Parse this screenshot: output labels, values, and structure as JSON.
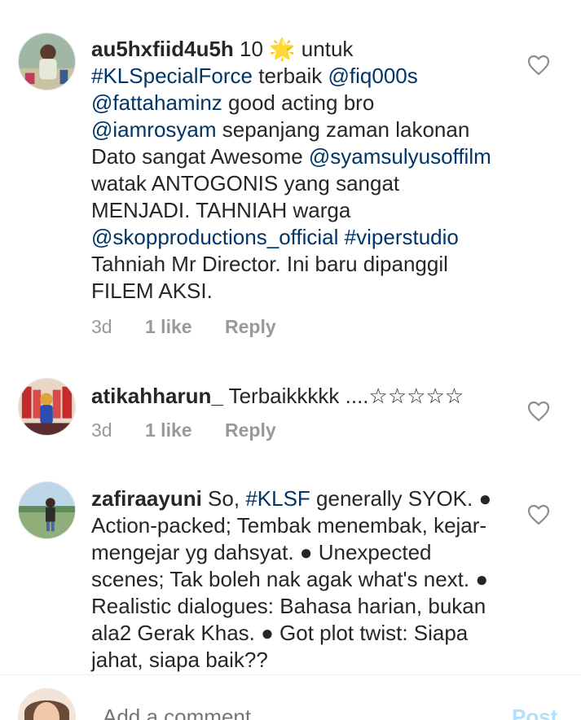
{
  "comments": [
    {
      "username": "au5hxfiid4u5h",
      "segments": [
        {
          "t": " 10 ",
          "link": false
        },
        {
          "t": "🌟",
          "link": false
        },
        {
          "t": " untuk ",
          "link": false
        },
        {
          "t": "#KLSpecialForce",
          "link": true
        },
        {
          "t": " terbaik ",
          "link": false
        },
        {
          "t": "@fiq000s",
          "link": true
        },
        {
          "t": " ",
          "link": false
        },
        {
          "t": "@fattahaminz",
          "link": true
        },
        {
          "t": " good acting bro ",
          "link": false
        },
        {
          "t": "@iamrosyam",
          "link": true
        },
        {
          "t": " sepanjang zaman lakonan Dato sangat Awesome ",
          "link": false
        },
        {
          "t": "@syamsulyusoffilm",
          "link": true
        },
        {
          "t": " watak ANTOGONIS yang sangat MENJADI. TAHNIAH warga ",
          "link": false
        },
        {
          "t": "@skopproductions_official",
          "link": true
        },
        {
          "t": " ",
          "link": false
        },
        {
          "t": "#viperstudio",
          "link": true
        },
        {
          "t": " Tahniah Mr Director. Ini baru dipanggil FILEM AKSI.",
          "link": false
        }
      ],
      "time": "3d",
      "likes": "1 like",
      "reply": "Reply"
    },
    {
      "username": "atikahharun_",
      "segments": [
        {
          "t": " Terbaikkkkk ....☆☆☆☆☆",
          "link": false
        }
      ],
      "time": "3d",
      "likes": "1 like",
      "reply": "Reply"
    },
    {
      "username": "zafiraayuni",
      "segments": [
        {
          "t": " So, ",
          "link": false
        },
        {
          "t": "#KLSF",
          "link": true
        },
        {
          "t": " generally SYOK. ● Action-packed; Tembak menembak, kejar-mengejar yg dahsyat. ● Unexpected scenes; Tak boleh nak agak what's next. ● Realistic dialogues: Bahasa harian, bukan ala2 Gerak Khas. ● Got plot twist: Siapa jahat, siapa baik??",
          "link": false
        }
      ]
    }
  ],
  "composer": {
    "placeholder": "Add a comment...",
    "post_label": "Post"
  },
  "colors": {
    "link": "#003569",
    "meta": "#999999",
    "post": "#b2dffc"
  },
  "icons": {
    "like": "heart-outline-icon"
  }
}
